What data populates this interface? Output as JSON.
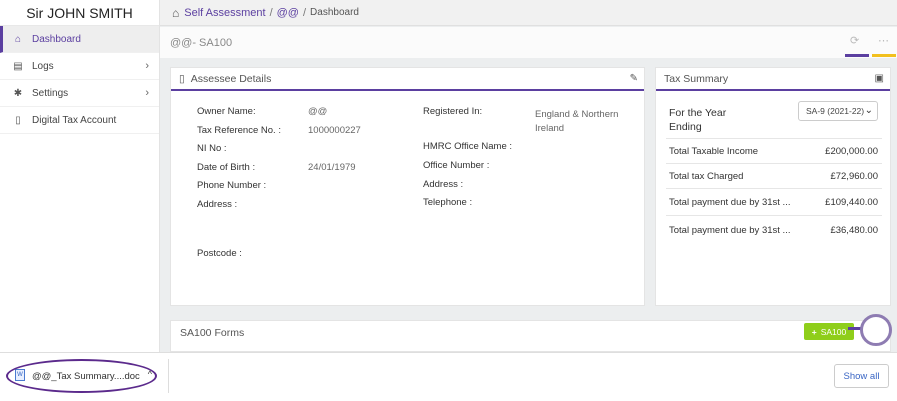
{
  "sidebar": {
    "user_name": "Sir JOHN SMITH",
    "items": [
      {
        "label": "Dashboard",
        "icon": "home-icon"
      },
      {
        "label": "Logs",
        "icon": "file-icon"
      },
      {
        "label": "Settings",
        "icon": "gear-icon"
      },
      {
        "label": "Digital Tax Account",
        "icon": "document-icon"
      }
    ]
  },
  "breadcrumb": {
    "first": "Self Assessment",
    "second": "@@",
    "third": "Dashboard"
  },
  "page": {
    "title": "@@- SA100"
  },
  "assessee": {
    "heading": "Assessee Details",
    "owner_name_label": "Owner Name:",
    "owner_name_value": "@@",
    "tax_ref_label": "Tax Reference No. :",
    "tax_ref_value": "1000000227",
    "ni_label": "NI No :",
    "dob_label": "Date of Birth :",
    "dob_value": "24/01/1979",
    "phone_label": "Phone Number :",
    "address_label": "Address :",
    "postcode_label": "Postcode :",
    "registered_label": "Registered In:",
    "registered_value_line1": "England & Northern",
    "registered_value_line2": "Ireland",
    "hmrc_office_label": "HMRC Office Name :",
    "office_number_label": "Office Number :",
    "office_address_label": "Address :",
    "telephone_label": "Telephone :"
  },
  "tax_summary": {
    "heading": "Tax Summary",
    "year_label_line1": "For the Year",
    "year_label_line2": "Ending",
    "year_selected": "SA-9 (2021-22)",
    "rows": [
      {
        "label": "Total Taxable Income",
        "value": "£200,000.00"
      },
      {
        "label": "Total tax Charged",
        "value": "£72,960.00"
      },
      {
        "label": "Total payment due by 31st ...",
        "value": "£109,440.00"
      },
      {
        "label": "Total payment due by 31st ...",
        "value": "£36,480.00"
      }
    ]
  },
  "forms": {
    "heading": "SA100 Forms",
    "add_button": "SA100",
    "add_plus": "+"
  },
  "download_bar": {
    "filename": "@@_Tax Summary....doc",
    "show_all": "Show all"
  },
  "colors": {
    "accent": "#5b3fa0",
    "highlight": "#f2c01e",
    "add_button": "#8fce1a"
  }
}
